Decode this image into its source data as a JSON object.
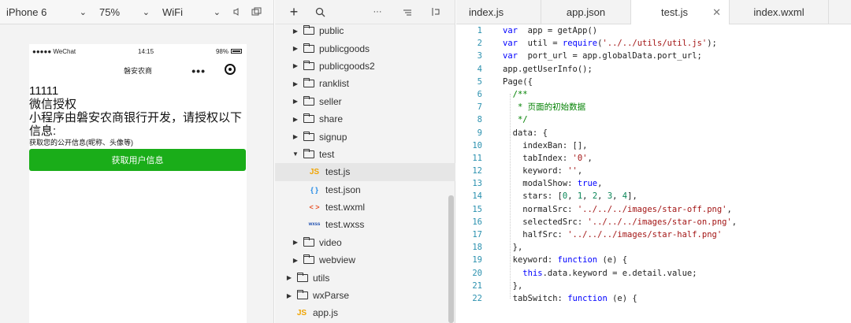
{
  "simulator": {
    "device": "iPhone 6",
    "zoom": "75%",
    "network": "WiFi",
    "status": {
      "carrier": "●●●●● WeChat",
      "time": "14:15",
      "battery": "98%"
    },
    "nav_title": "磐安农商",
    "nav_menu": "•••",
    "content": {
      "line1": "11111",
      "line2": "微信授权",
      "line3": "小程序由磐安农商银行开发，请授权以下信息:",
      "line4": "获取您的公开信息(昵称、头像等)",
      "button": "获取用户信息"
    }
  },
  "tree_toolbar": {
    "add": "+",
    "search": "🔍",
    "more": "···",
    "sort": "⇤",
    "collapse": "⇥"
  },
  "tree": [
    {
      "name": "public",
      "type": "folder",
      "level": 1,
      "expanded": false
    },
    {
      "name": "publicgoods",
      "type": "folder",
      "level": 1,
      "expanded": false
    },
    {
      "name": "publicgoods2",
      "type": "folder",
      "level": 1,
      "expanded": false
    },
    {
      "name": "ranklist",
      "type": "folder",
      "level": 1,
      "expanded": false
    },
    {
      "name": "seller",
      "type": "folder",
      "level": 1,
      "expanded": false
    },
    {
      "name": "share",
      "type": "folder",
      "level": 1,
      "expanded": false
    },
    {
      "name": "signup",
      "type": "folder",
      "level": 1,
      "expanded": false
    },
    {
      "name": "test",
      "type": "folder",
      "level": 1,
      "expanded": true
    },
    {
      "name": "test.js",
      "type": "js",
      "level": 2,
      "active": true,
      "icon": "JS"
    },
    {
      "name": "test.json",
      "type": "json",
      "level": 2,
      "icon": "{ }"
    },
    {
      "name": "test.wxml",
      "type": "wxml",
      "level": 2,
      "icon": "< >"
    },
    {
      "name": "test.wxss",
      "type": "wxss",
      "level": 2,
      "icon": "wxss"
    },
    {
      "name": "video",
      "type": "folder",
      "level": 1,
      "expanded": false
    },
    {
      "name": "webview",
      "type": "folder",
      "level": 1,
      "expanded": false
    },
    {
      "name": "utils",
      "type": "folder",
      "level": 0,
      "expanded": false
    },
    {
      "name": "wxParse",
      "type": "folder",
      "level": 0,
      "expanded": false
    },
    {
      "name": "app.js",
      "type": "js",
      "level": 0,
      "icon": "JS"
    }
  ],
  "tabs": [
    {
      "label": "index.js",
      "active": false
    },
    {
      "label": "app.json",
      "active": false
    },
    {
      "label": "test.js",
      "active": true,
      "close": "✕"
    },
    {
      "label": "index.wxml",
      "active": false
    }
  ],
  "code": [
    [
      [
        "kw",
        "var"
      ],
      [
        "",
        "  app = getApp()"
      ]
    ],
    [
      [
        "kw",
        "var"
      ],
      [
        "",
        "  util = "
      ],
      [
        "kw",
        "require"
      ],
      [
        "",
        "("
      ],
      [
        "str",
        "'../../utils/util.js'"
      ],
      [
        "",
        ");"
      ]
    ],
    [
      [
        "kw",
        "var"
      ],
      [
        "",
        "  port_url = app.globalData.port_url;"
      ]
    ],
    [
      [
        "",
        "app.getUserInfo();"
      ]
    ],
    [
      [
        "",
        "Page({"
      ]
    ],
    [
      [
        "cm",
        "  /**"
      ]
    ],
    [
      [
        "cm",
        "   * 页面的初始数据"
      ]
    ],
    [
      [
        "cm",
        "   */"
      ]
    ],
    [
      [
        "",
        "  data: {"
      ]
    ],
    [
      [
        "",
        "    indexBan: [],"
      ]
    ],
    [
      [
        "",
        "    tabIndex: "
      ],
      [
        "str",
        "'0'"
      ],
      [
        "",
        ","
      ]
    ],
    [
      [
        "",
        "    keyword: "
      ],
      [
        "str",
        "''"
      ],
      [
        "",
        ","
      ]
    ],
    [
      [
        "",
        "    modalShow: "
      ],
      [
        "kw",
        "true"
      ],
      [
        "",
        ","
      ]
    ],
    [
      [
        "",
        "    stars: ["
      ],
      [
        "nm",
        "0"
      ],
      [
        "",
        ", "
      ],
      [
        "nm",
        "1"
      ],
      [
        "",
        ", "
      ],
      [
        "nm",
        "2"
      ],
      [
        "",
        ", "
      ],
      [
        "nm",
        "3"
      ],
      [
        "",
        ", "
      ],
      [
        "nm",
        "4"
      ],
      [
        "",
        "],"
      ]
    ],
    [
      [
        "",
        "    normalSrc: "
      ],
      [
        "str",
        "'../../../images/star-off.png'"
      ],
      [
        "",
        ","
      ]
    ],
    [
      [
        "",
        "    selectedSrc: "
      ],
      [
        "str",
        "'../../../images/star-on.png'"
      ],
      [
        "",
        ","
      ]
    ],
    [
      [
        "",
        "    halfSrc: "
      ],
      [
        "str",
        "'../../../images/star-half.png'"
      ]
    ],
    [
      [
        "",
        "  },"
      ]
    ],
    [
      [
        "",
        "  keyword: "
      ],
      [
        "kw",
        "function"
      ],
      [
        "",
        " (e) {"
      ]
    ],
    [
      [
        "",
        "    "
      ],
      [
        "kw",
        "this"
      ],
      [
        "",
        ".data.keyword = e.detail.value;"
      ]
    ],
    [
      [
        "",
        "  },"
      ]
    ],
    [
      [
        "",
        "  tabSwitch: "
      ],
      [
        "kw",
        "function"
      ],
      [
        "",
        " (e) {"
      ]
    ]
  ]
}
